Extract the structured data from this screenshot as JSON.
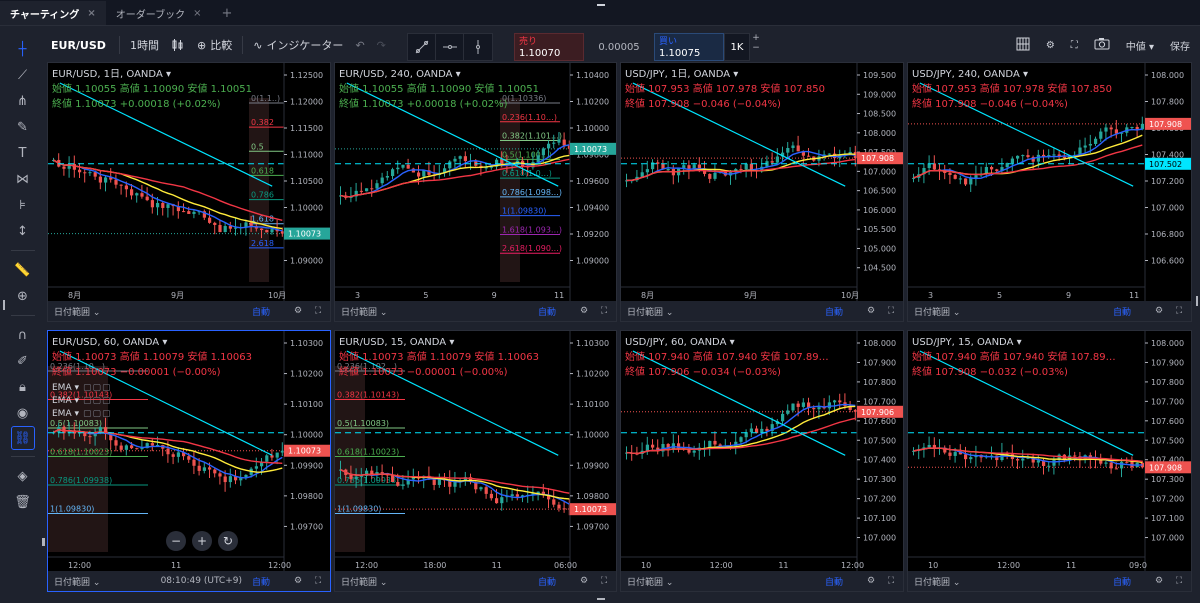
{
  "tabs": [
    {
      "label": "チャーティング",
      "close": "×"
    },
    {
      "label": "オーダーブック",
      "close": "×"
    }
  ],
  "tab_add": "+",
  "toolbar": {
    "symbol": "EUR/USD",
    "interval": "1時間",
    "candle_icon": "candles-icon",
    "compare": "比較",
    "indicators": "インジケーター",
    "undo": "↶",
    "redo": "↷"
  },
  "trade": {
    "sell_label": "売り",
    "sell_price": "1.10070",
    "spread": "0.00005",
    "buy_label": "買い",
    "buy_price": "1.10075",
    "qty": "1K",
    "plus": "+",
    "minus": "−"
  },
  "top_right": {
    "layout": "layout-grid-icon",
    "settings": "gear-icon",
    "fullscreen": "fullscreen-icon",
    "snapshot": "camera-icon",
    "size": "中値 ▾",
    "save": "保存"
  },
  "colors": {
    "up": "#26a69a",
    "down": "#ef5350",
    "ema_fast": "#2962ff",
    "ema_mid": "#ffeb3b",
    "ema_slow": "#f23645",
    "trend": "#00e5ff",
    "accent": "#2962ff"
  },
  "panes": [
    {
      "title": "EUR/USD, 1日, OANDA ▾",
      "line1": "始値 1.10055  高値 1.10090  安値 1.10051",
      "line2": "終値 1.10073  +0.00018 (+0.02%)",
      "dir": "up",
      "yticks": [
        "1.12500",
        "1.12000",
        "1.11500",
        "1.11000",
        "1.10500",
        "1.10000",
        "1.09500",
        "1.09000"
      ],
      "price_tag": "1.10073",
      "xticks": [
        "8月",
        "9月",
        "10月"
      ],
      "foot": {
        "range": "日付範囲 ⌄",
        "auto": "自動"
      },
      "fib": [
        "0(1.1..)",
        "0.382",
        "0.5",
        "0.618",
        "0.786",
        "1.618",
        "2.618"
      ]
    },
    {
      "title": "EUR/USD, 240, OANDA ▾",
      "line1": "始値 1.10055  高値 1.10090  安値 1.10051",
      "line2": "終値 1.10073  +0.00018 (+0.02%)",
      "dir": "up",
      "yticks": [
        "1.10400",
        "1.10200",
        "1.10000",
        "1.09800",
        "1.09600",
        "1.09400",
        "1.09200",
        "1.09000"
      ],
      "price_tag": "1.10073",
      "xticks": [
        "3",
        "5",
        "9",
        "11"
      ],
      "foot": {
        "range": "日付範囲 ⌄",
        "auto": "自動"
      },
      "fib": [
        "0(1.10336)",
        "0.236(1.10…)",
        "0.382(1.101…)",
        "0.5(1.100…)",
        "0.618(1.0…)",
        "0.786(1.098…)",
        "1(1.09830)",
        "1.618(1.093…)",
        "2.618(1.090…)"
      ]
    },
    {
      "title": "USD/JPY, 1日, OANDA ▾",
      "line1": "始値 107.953  高値 107.978  安値 107.850",
      "line2": "終値 107.908  −0.046 (−0.04%)",
      "dir": "dn",
      "yticks": [
        "109.500",
        "109.000",
        "108.500",
        "108.000",
        "107.500",
        "107.000",
        "106.500",
        "106.000",
        "105.500",
        "105.000",
        "104.500"
      ],
      "price_tag": "107.908",
      "xticks": [
        "8月",
        "9月",
        "10月"
      ],
      "foot": {
        "range": "日付範囲 ⌄",
        "auto": "自動"
      }
    },
    {
      "title": "USD/JPY, 240, OANDA ▾",
      "line1": "始値 107.953  高値 107.978  安値 107.850",
      "line2": "終値 107.908  −0.046 (−0.04%)",
      "dir": "dn",
      "yticks": [
        "108.000",
        "107.800",
        "107.600",
        "107.400",
        "107.200",
        "107.000",
        "106.800",
        "106.600"
      ],
      "price_tag": "107.908",
      "price_tag2": "107.502",
      "xticks": [
        "3",
        "5",
        "9",
        "11"
      ],
      "foot": {
        "range": "日付範囲 ⌄",
        "auto": "自動"
      }
    },
    {
      "title": "EUR/USD, 60, OANDA ▾",
      "line1": "始値 1.10073  高値 1.10079  安値 1.10063",
      "line2": "終値 1.10073  −0.00001 (−0.00%)",
      "dir": "dn",
      "emas": [
        "EMA ▾",
        "EMA ▾",
        "EMA ▾"
      ],
      "ema_boxes": "▢▢▢",
      "yticks": [
        "1.10300",
        "1.10200",
        "1.10100",
        "1.10000",
        "1.09900",
        "1.09800",
        "1.09700"
      ],
      "price_tag": "1.10073",
      "xticks": [
        "12:00",
        "11",
        "12:00"
      ],
      "fib": [
        "0.236(1.10…)",
        "0.382(1.10143)",
        "0.5(1.10083)",
        "0.618(1.10023)",
        "0.786(1.09938)",
        "1(1.09830)"
      ],
      "zoom": {
        "minus": "−",
        "plus": "+",
        "reset": "↻"
      },
      "foot": {
        "range": "日付範囲 ⌄",
        "clock": "08:10:49 (UTC+9)",
        "auto": "自動"
      }
    },
    {
      "title": "EUR/USD, 15, OANDA ▾",
      "line1": "始値 1.10073  高値 1.10079  安値 1.10063",
      "line2": "終値 1.10073  −0.00001 (−0.00%)",
      "dir": "dn",
      "yticks": [
        "1.10300",
        "1.10200",
        "1.10100",
        "1.10000",
        "1.09900",
        "1.09800",
        "1.09700"
      ],
      "price_tag": "1.10073",
      "xticks": [
        "12:00",
        "18:00",
        "11",
        "06:00"
      ],
      "fib": [
        "0.236(1.102…)",
        "0.382(1.10143)",
        "0.5(1.10083)",
        "0.618(1.10023)",
        "0.786(1.09938)",
        "1(1.09830)"
      ],
      "foot": {
        "range": "日付範囲 ⌄",
        "auto": "自動"
      }
    },
    {
      "title": "USD/JPY, 60, OANDA ▾",
      "line1": "始値 107.940  高値 107.940  安値 107.89…",
      "line2": "終値 107.906  −0.034 (−0.03%)",
      "dir": "dn",
      "yticks": [
        "108.000",
        "107.900",
        "107.800",
        "107.700",
        "107.600",
        "107.500",
        "107.400",
        "107.300",
        "107.200",
        "107.100",
        "107.000"
      ],
      "price_tag": "107.906",
      "xticks": [
        "10",
        "12:00",
        "11",
        "12:00"
      ],
      "foot": {
        "range": "日付範囲 ⌄",
        "auto": "自動"
      }
    },
    {
      "title": "USD/JPY, 15, OANDA ▾",
      "line1": "始値 107.940  高値 107.940  安値 107.89…",
      "line2": "終値 107.908  −0.032 (−0.03%)",
      "dir": "dn",
      "yticks": [
        "108.000",
        "107.900",
        "107.800",
        "107.700",
        "107.600",
        "107.500",
        "107.400",
        "107.300",
        "107.200",
        "107.100",
        "107.000"
      ],
      "price_tag": "107.908",
      "xticks": [
        "10",
        "12:00",
        "11",
        "09:0"
      ],
      "foot": {
        "range": "日付範囲 ⌄",
        "auto": "自動"
      }
    }
  ]
}
